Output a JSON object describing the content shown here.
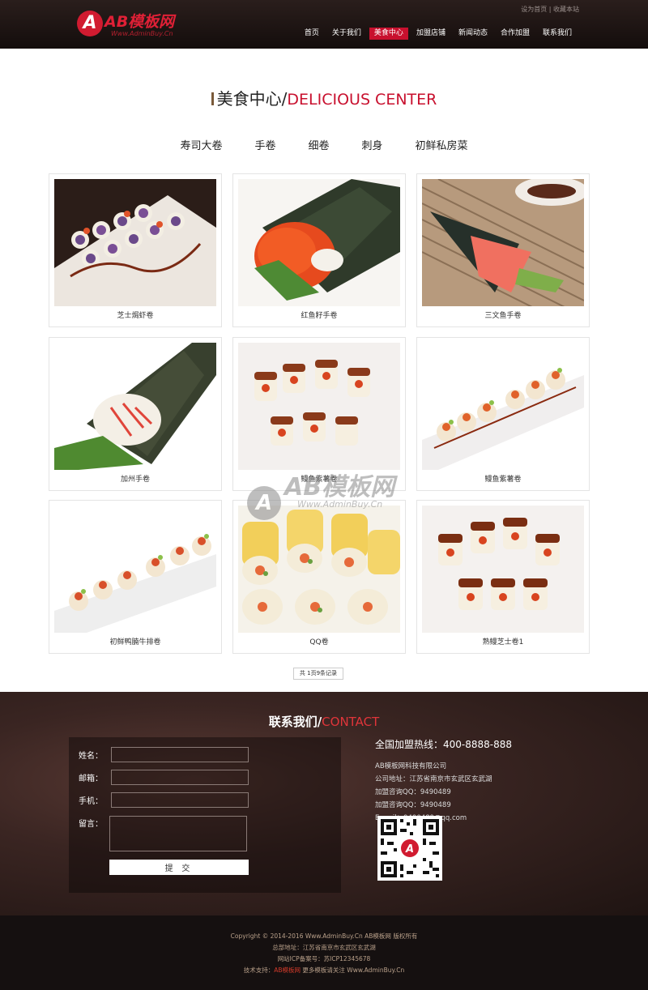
{
  "header": {
    "logo_mark": "A",
    "logo_text": "AB模板网",
    "logo_sub": "Www.AdminBuy.Cn",
    "top_links": [
      "设为首页",
      "收藏本站"
    ],
    "nav": [
      "首页",
      "关于我们",
      "美食中心",
      "加盟店铺",
      "新闻动态",
      "合作加盟",
      "联系我们"
    ],
    "active_nav": "美食中心"
  },
  "section": {
    "title_cn": "美食中心/",
    "title_en": "DELICIOUS CENTER",
    "tabs": [
      "寿司大卷",
      "手卷",
      "细卷",
      "刺身",
      "初鲜私房菜"
    ]
  },
  "products": [
    {
      "name": "芝士焗虾卷",
      "icon": "sushi-roll-photo"
    },
    {
      "name": "红鱼籽手卷",
      "icon": "hand-roll-roe-photo"
    },
    {
      "name": "三文鱼手卷",
      "icon": "salmon-hand-roll-photo"
    },
    {
      "name": "加州手卷",
      "icon": "california-hand-roll-photo"
    },
    {
      "name": "鳗鱼紫薯卷",
      "icon": "eel-roll-photo"
    },
    {
      "name": "鳗鱼紫薯卷",
      "icon": "eel-roll-plate-photo"
    },
    {
      "name": "初鲜鸭腩牛排卷",
      "icon": "beef-roll-photo"
    },
    {
      "name": "QQ卷",
      "icon": "qq-roll-photo"
    },
    {
      "name": "熟鳗芝士卷1",
      "icon": "cooked-eel-roll-photo"
    }
  ],
  "pager": "共 1页9条记录",
  "watermark": {
    "mark": "A",
    "text": "AB模板网",
    "sub": "Www.AdminBuy.Cn"
  },
  "contact": {
    "title_cn": "联系我们/",
    "title_en": "CONTACT",
    "labels": {
      "name": "姓名：",
      "email": "邮箱：",
      "phone": "手机：",
      "message": "留言："
    },
    "submit": "提 交",
    "hotline": "全国加盟热线：400-8888-888",
    "company": "AB模板网科技有限公司",
    "address": "公司地址：江苏省南京市玄武区玄武湖",
    "qq1": "加盟咨询QQ：9490489",
    "qq2": "加盟咨询QQ：9490489",
    "email": "E-mail：9490489@qq.com"
  },
  "footer": {
    "copyright": "Copyright © 2014-2016 Www.AdminBuy.Cn AB模板网 版权所有",
    "address": "总部地址：江苏省南京市玄武区玄武湖",
    "icp": "网站ICP备案号：苏ICP12345678",
    "support_prefix": "技术支持：",
    "support_link": "AB模板网",
    "support_suffix": " 更多模板请关注 Www.AdminBuy.Cn"
  },
  "colors": {
    "accent": "#c8102e",
    "header_bg": "#1c1412",
    "footer_bg": "#151010"
  }
}
